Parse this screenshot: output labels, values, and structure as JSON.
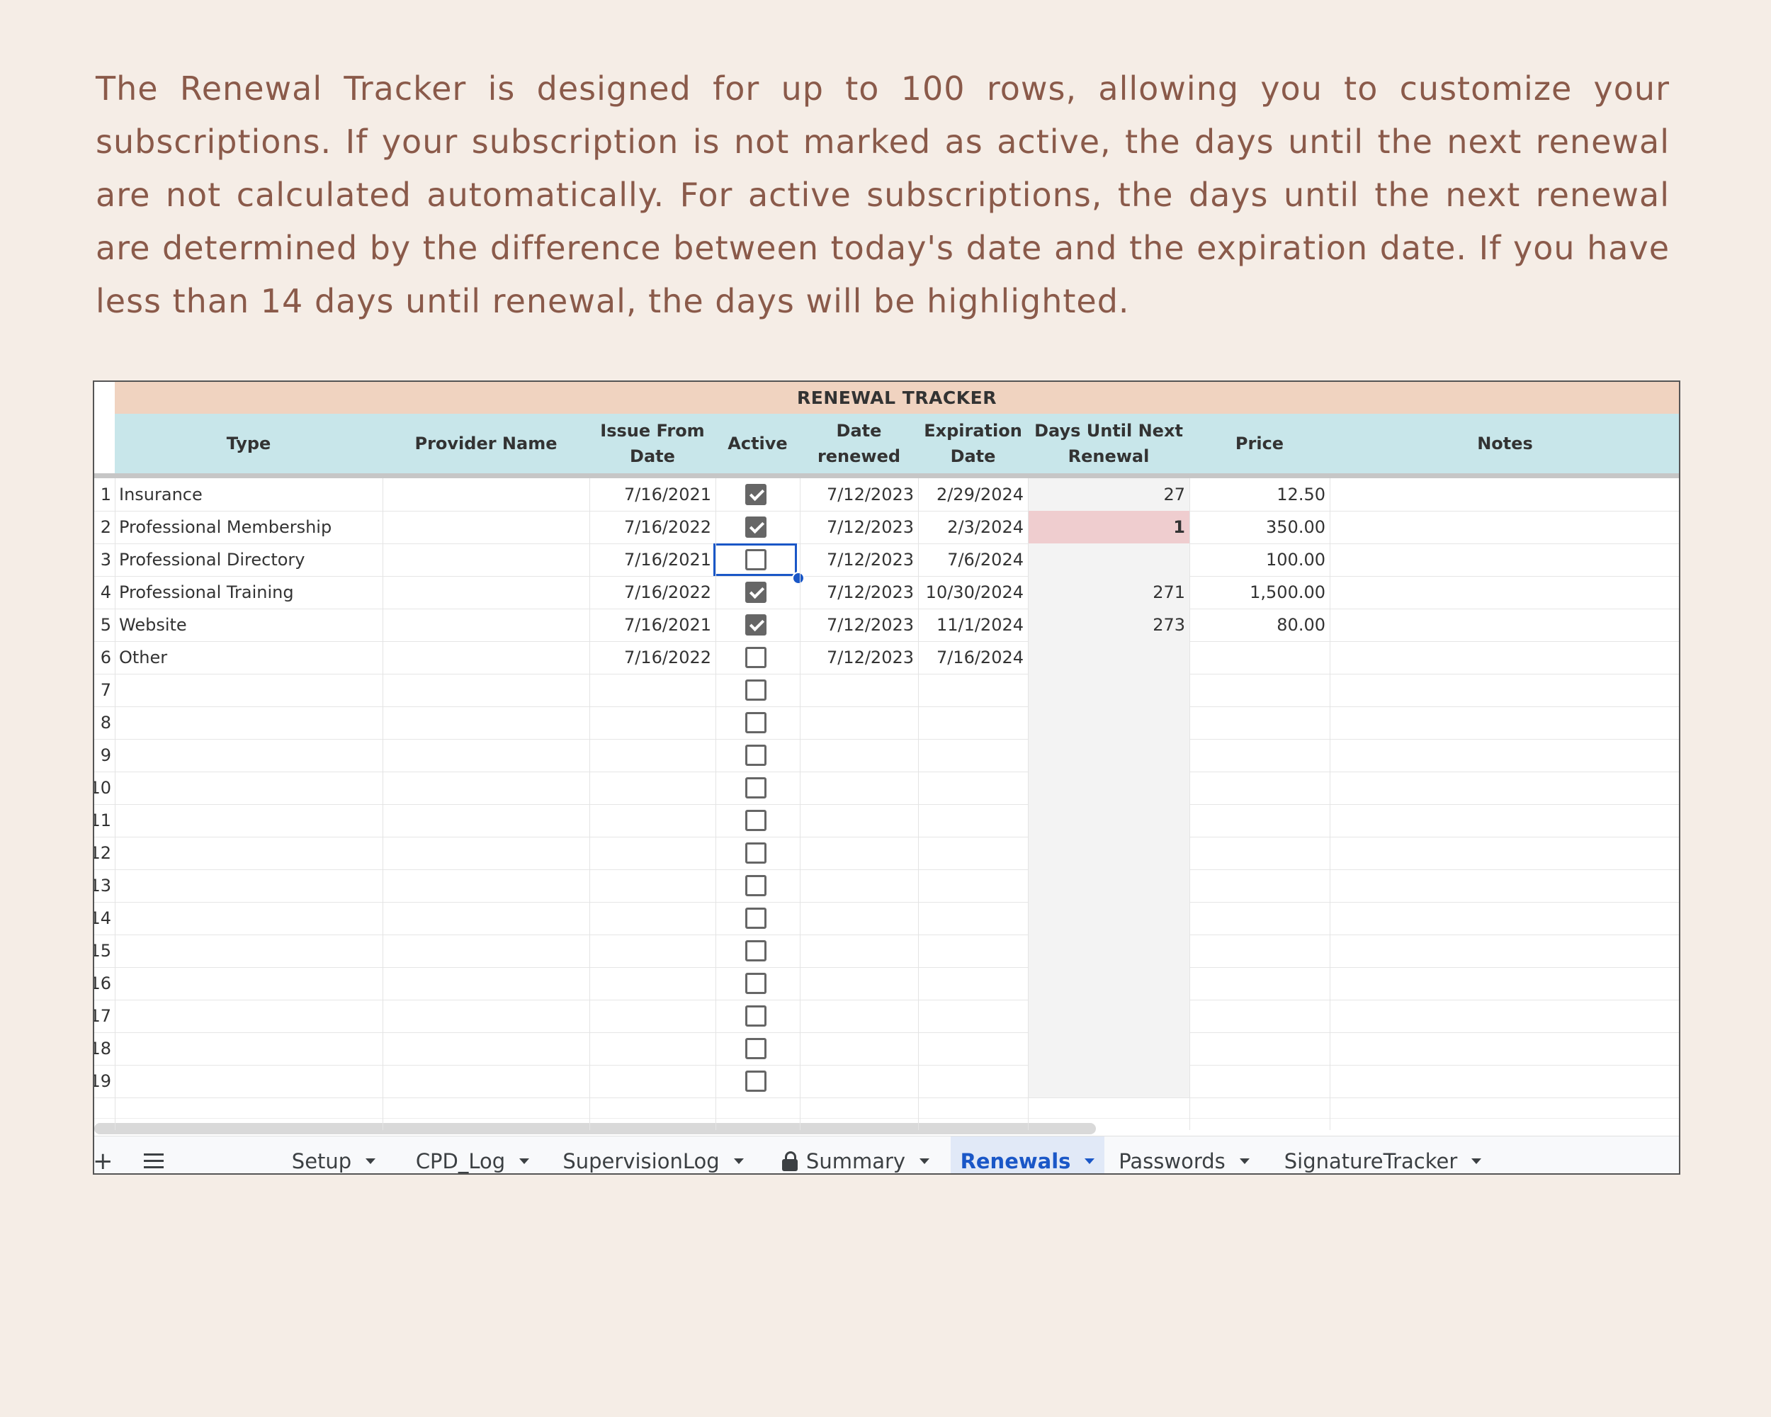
{
  "intro_text": "The Renewal Tracker is designed for up to 100 rows, allowing you to customize your subscriptions. If your subscription is not marked as active, the days until the next renewal are not calculated automatically. For active subscriptions, the days until the next renewal are determined by the difference between today's date and the expiration date. If you have less than 14 days until renewal, the days will be highlighted.",
  "sheet": {
    "title": "RENEWAL TRACKER",
    "headers": {
      "type": "Type",
      "provider": "Provider Name",
      "issue_line1": "Issue From",
      "issue_line2": "Date",
      "active": "Active",
      "renewed_line1": "Date",
      "renewed_line2": "renewed",
      "expiration_line1": "Expiration",
      "expiration_line2": "Date",
      "days_line1": "Days Until Next",
      "days_line2": "Renewal",
      "price": "Price",
      "notes": "Notes"
    },
    "rows": [
      {
        "num": "1",
        "type": "Insurance",
        "issue": "7/16/2021",
        "active": true,
        "renewed": "7/12/2023",
        "expiration": "2/29/2024",
        "days": "27",
        "price": "12.50",
        "highlight": false
      },
      {
        "num": "2",
        "type": "Professional Membership",
        "issue": "7/16/2022",
        "active": true,
        "renewed": "7/12/2023",
        "expiration": "2/3/2024",
        "days": "1",
        "price": "350.00",
        "highlight": true
      },
      {
        "num": "3",
        "type": "Professional Directory",
        "issue": "7/16/2021",
        "active": false,
        "renewed": "7/12/2023",
        "expiration": "7/6/2024",
        "days": "",
        "price": "100.00",
        "highlight": false
      },
      {
        "num": "4",
        "type": "Professional Training",
        "issue": "7/16/2022",
        "active": true,
        "renewed": "7/12/2023",
        "expiration": "10/30/2024",
        "days": "271",
        "price": "1,500.00",
        "highlight": false
      },
      {
        "num": "5",
        "type": "Website",
        "issue": "7/16/2021",
        "active": true,
        "renewed": "7/12/2023",
        "expiration": "11/1/2024",
        "days": "273",
        "price": "80.00",
        "highlight": false
      },
      {
        "num": "6",
        "type": "Other",
        "issue": "7/16/2022",
        "active": false,
        "renewed": "7/12/2023",
        "expiration": "7/16/2024",
        "days": "",
        "price": "",
        "highlight": false
      },
      {
        "num": "7",
        "active": false
      },
      {
        "num": "8",
        "active": false
      },
      {
        "num": "9",
        "active": false
      },
      {
        "num": "10",
        "active": false
      },
      {
        "num": "11",
        "active": false
      },
      {
        "num": "12",
        "active": false
      },
      {
        "num": "13",
        "active": false
      },
      {
        "num": "14",
        "active": false
      },
      {
        "num": "15",
        "active": false
      },
      {
        "num": "16",
        "active": false
      },
      {
        "num": "17",
        "active": false
      },
      {
        "num": "18",
        "active": false
      },
      {
        "num": "19",
        "active": false
      }
    ],
    "selected_row": 3
  },
  "tabs": [
    {
      "label": "Setup",
      "active": false,
      "locked": false
    },
    {
      "label": "CPD_Log",
      "active": false,
      "locked": false
    },
    {
      "label": "SupervisionLog",
      "active": false,
      "locked": false
    },
    {
      "label": "Summary",
      "active": false,
      "locked": true
    },
    {
      "label": "Renewals",
      "active": true,
      "locked": false
    },
    {
      "label": "Passwords",
      "active": false,
      "locked": false
    },
    {
      "label": "SignatureTracker",
      "active": false,
      "locked": false
    }
  ],
  "colors": {
    "background": "#f5ede6",
    "intro_text": "#8a5a4a",
    "title_band": "#f0d3c0",
    "header_band": "#c8e6ea",
    "days_highlight": "#efcdcf",
    "active_tab": "#1a57c7"
  },
  "icons": {
    "add_sheet": "plus-icon",
    "all_sheets": "menu-icon",
    "protected": "lock-icon",
    "tab_menu": "caret-down-icon"
  }
}
